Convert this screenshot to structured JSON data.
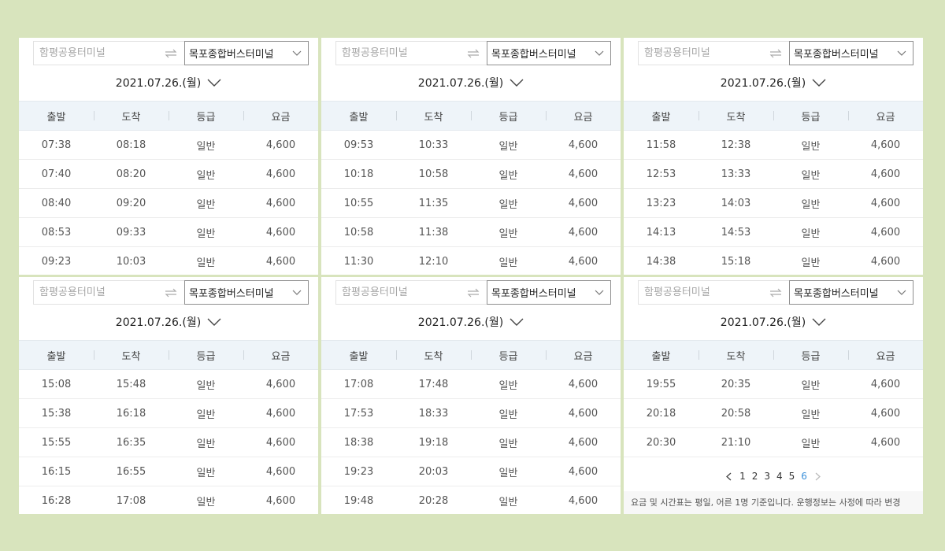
{
  "panels": [
    {
      "origin_placeholder": "함평공용터미널",
      "destination": "목포종합버스터미널",
      "date": "2021.07.26.(월)",
      "headers": [
        "출발",
        "도착",
        "등급",
        "요금"
      ],
      "rows": [
        [
          "07:38",
          "08:18",
          "일반",
          "4,600"
        ],
        [
          "07:40",
          "08:20",
          "일반",
          "4,600"
        ],
        [
          "08:40",
          "09:20",
          "일반",
          "4,600"
        ],
        [
          "08:53",
          "09:33",
          "일반",
          "4,600"
        ],
        [
          "09:23",
          "10:03",
          "일반",
          "4,600"
        ]
      ]
    },
    {
      "origin_placeholder": "함평공용터미널",
      "destination": "목포종합버스터미널",
      "date": "2021.07.26.(월)",
      "headers": [
        "출발",
        "도착",
        "등급",
        "요금"
      ],
      "rows": [
        [
          "09:53",
          "10:33",
          "일반",
          "4,600"
        ],
        [
          "10:18",
          "10:58",
          "일반",
          "4,600"
        ],
        [
          "10:55",
          "11:35",
          "일반",
          "4,600"
        ],
        [
          "10:58",
          "11:38",
          "일반",
          "4,600"
        ],
        [
          "11:30",
          "12:10",
          "일반",
          "4,600"
        ]
      ]
    },
    {
      "origin_placeholder": "함평공용터미널",
      "destination": "목포종합버스터미널",
      "date": "2021.07.26.(월)",
      "headers": [
        "출발",
        "도착",
        "등급",
        "요금"
      ],
      "rows": [
        [
          "11:58",
          "12:38",
          "일반",
          "4,600"
        ],
        [
          "12:53",
          "13:33",
          "일반",
          "4,600"
        ],
        [
          "13:23",
          "14:03",
          "일반",
          "4,600"
        ],
        [
          "14:13",
          "14:53",
          "일반",
          "4,600"
        ],
        [
          "14:38",
          "15:18",
          "일반",
          "4,600"
        ]
      ]
    },
    {
      "origin_placeholder": "함평공용터미널",
      "destination": "목포종합버스터미널",
      "date": "2021.07.26.(월)",
      "headers": [
        "출발",
        "도착",
        "등급",
        "요금"
      ],
      "rows": [
        [
          "15:08",
          "15:48",
          "일반",
          "4,600"
        ],
        [
          "15:38",
          "16:18",
          "일반",
          "4,600"
        ],
        [
          "15:55",
          "16:35",
          "일반",
          "4,600"
        ],
        [
          "16:15",
          "16:55",
          "일반",
          "4,600"
        ],
        [
          "16:28",
          "17:08",
          "일반",
          "4,600"
        ]
      ]
    },
    {
      "origin_placeholder": "함평공용터미널",
      "destination": "목포종합버스터미널",
      "date": "2021.07.26.(월)",
      "headers": [
        "출발",
        "도착",
        "등급",
        "요금"
      ],
      "rows": [
        [
          "17:08",
          "17:48",
          "일반",
          "4,600"
        ],
        [
          "17:53",
          "18:33",
          "일반",
          "4,600"
        ],
        [
          "18:38",
          "19:18",
          "일반",
          "4,600"
        ],
        [
          "19:23",
          "20:03",
          "일반",
          "4,600"
        ],
        [
          "19:48",
          "20:28",
          "일반",
          "4,600"
        ]
      ]
    },
    {
      "origin_placeholder": "함평공용터미널",
      "destination": "목포종합버스터미널",
      "date": "2021.07.26.(월)",
      "headers": [
        "출발",
        "도착",
        "등급",
        "요금"
      ],
      "rows": [
        [
          "19:55",
          "20:35",
          "일반",
          "4,600"
        ],
        [
          "20:18",
          "20:58",
          "일반",
          "4,600"
        ],
        [
          "20:30",
          "21:10",
          "일반",
          "4,600"
        ]
      ],
      "pagination": {
        "pages": [
          "1",
          "2",
          "3",
          "4",
          "5",
          "6"
        ],
        "active": "6"
      },
      "notice": "요금 및 시간표는 평일, 어른 1명 기준입니다. 운행정보는 사정에 따라 변경"
    }
  ],
  "colors": {
    "page_background": "#d8e4bd",
    "header_background": "#eef4f9",
    "active_page": "#3a8fd9"
  },
  "icons": {
    "swap": "swap-arrows-icon",
    "dropdown": "chevron-down-icon",
    "prev": "chevron-left-icon",
    "next": "chevron-right-icon"
  }
}
